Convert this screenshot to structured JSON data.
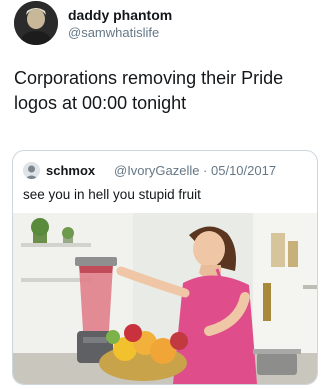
{
  "tweet": {
    "display_name": "daddy phantom",
    "handle": "@samwhatislife",
    "text": "Corporations removing their Pride logos at 00:00 tonight",
    "avatar_icon": "user-avatar-photo"
  },
  "quoted_tweet": {
    "display_name": "schmox",
    "meta": "@IvoryGazelle · 05/10/2017",
    "text": "see you in hell you stupid fruit",
    "avatar_icon": "user-avatar-photo",
    "image_icon": "woman-blending-fruit-photo"
  },
  "colors": {
    "text": "#14171a",
    "secondary": "#657786",
    "border": "#ccd6dd"
  }
}
